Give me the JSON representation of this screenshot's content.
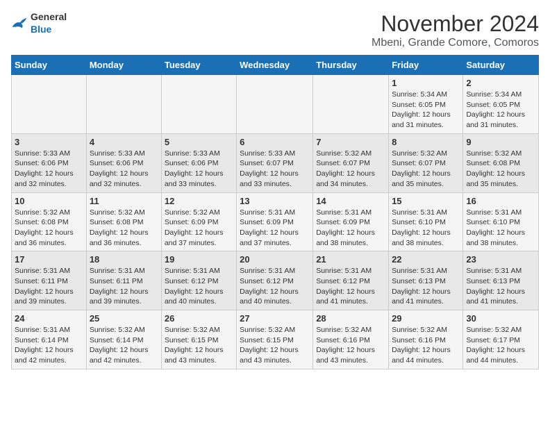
{
  "header": {
    "logo_general": "General",
    "logo_blue": "Blue",
    "title": "November 2024",
    "subtitle": "Mbeni, Grande Comore, Comoros"
  },
  "days_of_week": [
    "Sunday",
    "Monday",
    "Tuesday",
    "Wednesday",
    "Thursday",
    "Friday",
    "Saturday"
  ],
  "weeks": [
    [
      {
        "day": "",
        "info": ""
      },
      {
        "day": "",
        "info": ""
      },
      {
        "day": "",
        "info": ""
      },
      {
        "day": "",
        "info": ""
      },
      {
        "day": "",
        "info": ""
      },
      {
        "day": "1",
        "info": "Sunrise: 5:34 AM\nSunset: 6:05 PM\nDaylight: 12 hours and 31 minutes."
      },
      {
        "day": "2",
        "info": "Sunrise: 5:34 AM\nSunset: 6:05 PM\nDaylight: 12 hours and 31 minutes."
      }
    ],
    [
      {
        "day": "3",
        "info": "Sunrise: 5:33 AM\nSunset: 6:06 PM\nDaylight: 12 hours and 32 minutes."
      },
      {
        "day": "4",
        "info": "Sunrise: 5:33 AM\nSunset: 6:06 PM\nDaylight: 12 hours and 32 minutes."
      },
      {
        "day": "5",
        "info": "Sunrise: 5:33 AM\nSunset: 6:06 PM\nDaylight: 12 hours and 33 minutes."
      },
      {
        "day": "6",
        "info": "Sunrise: 5:33 AM\nSunset: 6:07 PM\nDaylight: 12 hours and 33 minutes."
      },
      {
        "day": "7",
        "info": "Sunrise: 5:32 AM\nSunset: 6:07 PM\nDaylight: 12 hours and 34 minutes."
      },
      {
        "day": "8",
        "info": "Sunrise: 5:32 AM\nSunset: 6:07 PM\nDaylight: 12 hours and 35 minutes."
      },
      {
        "day": "9",
        "info": "Sunrise: 5:32 AM\nSunset: 6:08 PM\nDaylight: 12 hours and 35 minutes."
      }
    ],
    [
      {
        "day": "10",
        "info": "Sunrise: 5:32 AM\nSunset: 6:08 PM\nDaylight: 12 hours and 36 minutes."
      },
      {
        "day": "11",
        "info": "Sunrise: 5:32 AM\nSunset: 6:08 PM\nDaylight: 12 hours and 36 minutes."
      },
      {
        "day": "12",
        "info": "Sunrise: 5:32 AM\nSunset: 6:09 PM\nDaylight: 12 hours and 37 minutes."
      },
      {
        "day": "13",
        "info": "Sunrise: 5:31 AM\nSunset: 6:09 PM\nDaylight: 12 hours and 37 minutes."
      },
      {
        "day": "14",
        "info": "Sunrise: 5:31 AM\nSunset: 6:09 PM\nDaylight: 12 hours and 38 minutes."
      },
      {
        "day": "15",
        "info": "Sunrise: 5:31 AM\nSunset: 6:10 PM\nDaylight: 12 hours and 38 minutes."
      },
      {
        "day": "16",
        "info": "Sunrise: 5:31 AM\nSunset: 6:10 PM\nDaylight: 12 hours and 38 minutes."
      }
    ],
    [
      {
        "day": "17",
        "info": "Sunrise: 5:31 AM\nSunset: 6:11 PM\nDaylight: 12 hours and 39 minutes."
      },
      {
        "day": "18",
        "info": "Sunrise: 5:31 AM\nSunset: 6:11 PM\nDaylight: 12 hours and 39 minutes."
      },
      {
        "day": "19",
        "info": "Sunrise: 5:31 AM\nSunset: 6:12 PM\nDaylight: 12 hours and 40 minutes."
      },
      {
        "day": "20",
        "info": "Sunrise: 5:31 AM\nSunset: 6:12 PM\nDaylight: 12 hours and 40 minutes."
      },
      {
        "day": "21",
        "info": "Sunrise: 5:31 AM\nSunset: 6:12 PM\nDaylight: 12 hours and 41 minutes."
      },
      {
        "day": "22",
        "info": "Sunrise: 5:31 AM\nSunset: 6:13 PM\nDaylight: 12 hours and 41 minutes."
      },
      {
        "day": "23",
        "info": "Sunrise: 5:31 AM\nSunset: 6:13 PM\nDaylight: 12 hours and 41 minutes."
      }
    ],
    [
      {
        "day": "24",
        "info": "Sunrise: 5:31 AM\nSunset: 6:14 PM\nDaylight: 12 hours and 42 minutes."
      },
      {
        "day": "25",
        "info": "Sunrise: 5:32 AM\nSunset: 6:14 PM\nDaylight: 12 hours and 42 minutes."
      },
      {
        "day": "26",
        "info": "Sunrise: 5:32 AM\nSunset: 6:15 PM\nDaylight: 12 hours and 43 minutes."
      },
      {
        "day": "27",
        "info": "Sunrise: 5:32 AM\nSunset: 6:15 PM\nDaylight: 12 hours and 43 minutes."
      },
      {
        "day": "28",
        "info": "Sunrise: 5:32 AM\nSunset: 6:16 PM\nDaylight: 12 hours and 43 minutes."
      },
      {
        "day": "29",
        "info": "Sunrise: 5:32 AM\nSunset: 6:16 PM\nDaylight: 12 hours and 44 minutes."
      },
      {
        "day": "30",
        "info": "Sunrise: 5:32 AM\nSunset: 6:17 PM\nDaylight: 12 hours and 44 minutes."
      }
    ]
  ]
}
